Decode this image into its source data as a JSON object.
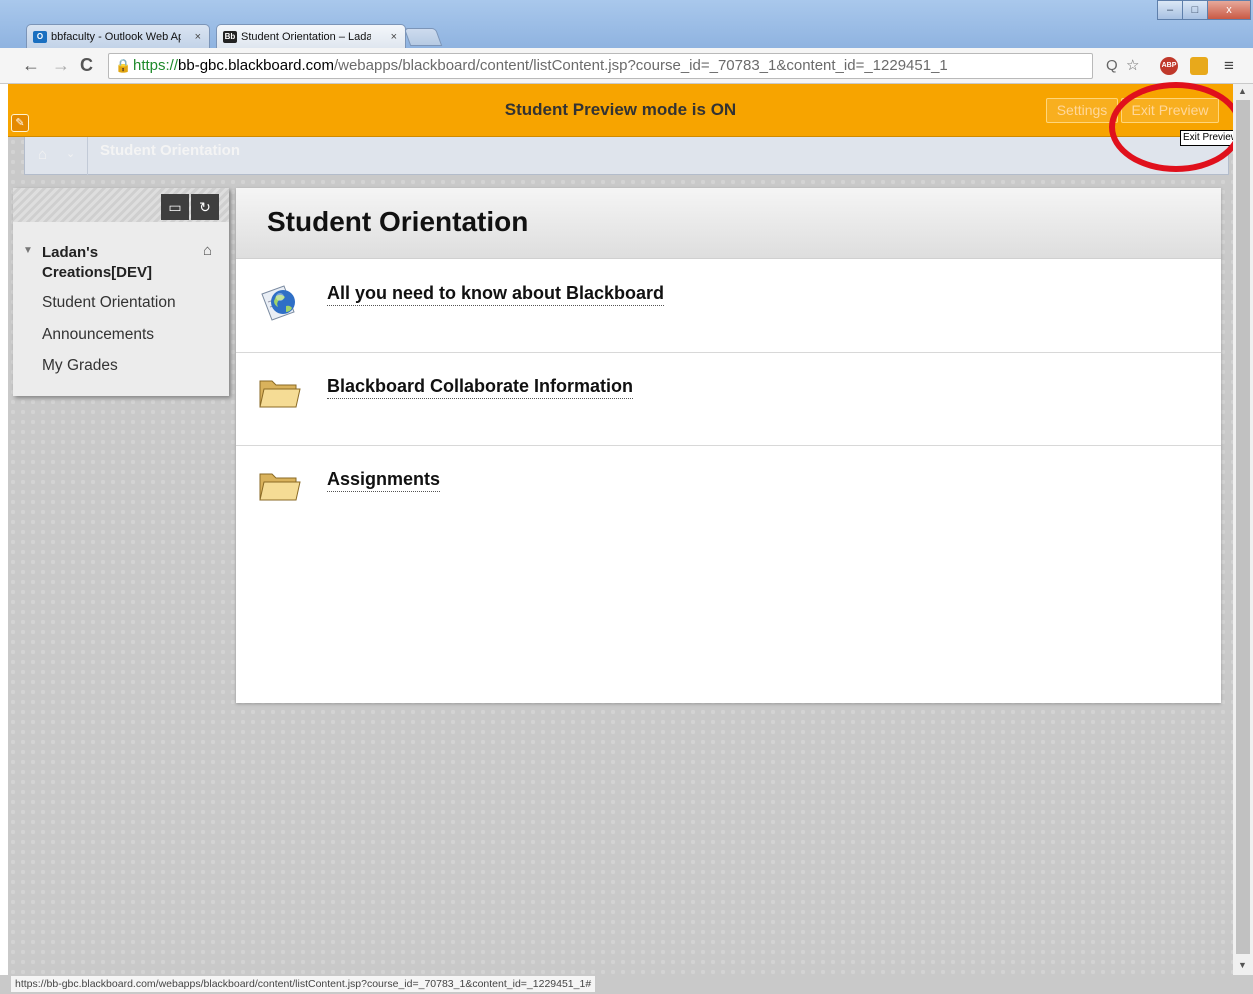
{
  "browser": {
    "tabs": [
      {
        "icon": "O",
        "icon_color": "#1a6fc0",
        "label": "bbfaculty - Outlook Web App",
        "close": "×"
      },
      {
        "icon": "Bb",
        "icon_color": "#222222",
        "label": "Student Orientation – Ladan's",
        "close": "×"
      }
    ],
    "window_controls": {
      "minimize": "–",
      "maximize": "□",
      "close": "x"
    },
    "nav": {
      "back": "←",
      "forward": "→",
      "reload": "C"
    },
    "url": {
      "lock": "🔒",
      "scheme": "https://",
      "host": "bb-gbc.blackboard.com",
      "path": "/webapps/blackboard/content/listContent.jsp?course_id=_70783_1&content_id=_1229451_1"
    },
    "toolbar_icons": {
      "search": "Q",
      "star": "☆",
      "abp": "ABP",
      "extension": "ext",
      "menu": "≡"
    },
    "status_url": "https://bb-gbc.blackboard.com/webapps/blackboard/content/listContent.jsp?course_id=_70783_1&content_id=_1229451_1#"
  },
  "preview_bar": {
    "message": "Student Preview mode is ON",
    "settings_button": "Settings",
    "exit_button": "Exit Preview",
    "tooltip": "Exit Preview",
    "accent": "#f7a400"
  },
  "breadcrumb": {
    "home_icon": "⌂",
    "chevron": "⌄",
    "current": "Student Orientation"
  },
  "course_menu": {
    "tool_icons": [
      "▭",
      "↻"
    ],
    "course_name": "Ladan's Creations[DEV]",
    "toggle_icon": "▼",
    "home_icon": "⌂",
    "items": [
      "Student Orientation",
      "Announcements",
      "My Grades"
    ]
  },
  "content": {
    "title": "Student Orientation",
    "items": [
      {
        "title": "All you need to know about Blackboard",
        "icon": "globe-document-icon"
      },
      {
        "title": "Blackboard Collaborate Information",
        "icon": "folder-icon"
      },
      {
        "title": "Assignments",
        "icon": "folder-icon"
      }
    ]
  },
  "annotation_color": "#e0101c"
}
